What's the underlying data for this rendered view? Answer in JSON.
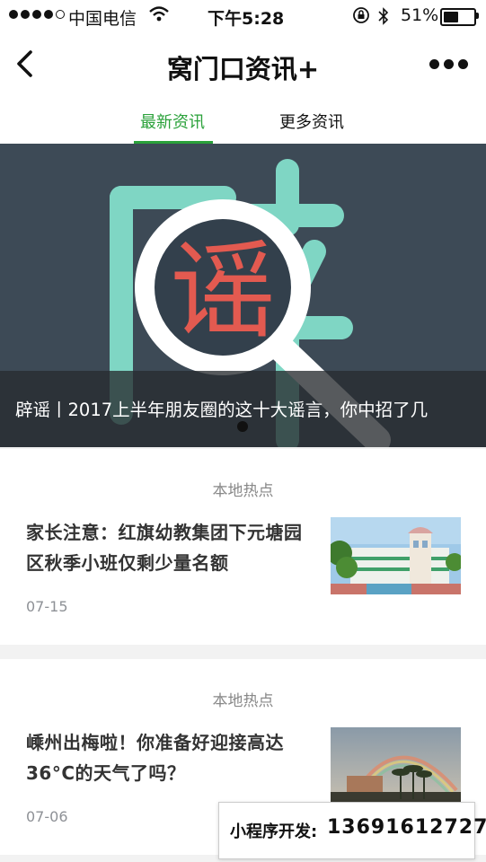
{
  "status_bar": {
    "carrier": "中国电信",
    "time": "下午5:28",
    "battery_percent": "51%",
    "battery_level": 0.51
  },
  "nav": {
    "title": "窝门口资讯+",
    "back_icon": "chevron-left-icon",
    "more_icon": "more-dots-icon"
  },
  "tabs": [
    {
      "label": "最新资讯",
      "active": true
    },
    {
      "label": "更多资讯",
      "active": false
    }
  ],
  "colors": {
    "accent": "#2aa13a",
    "banner_bg": "#3d4a56"
  },
  "banner": {
    "caption": "辟谣丨2017上半年朋友圈的这十大谣言，你中招了几",
    "image_glyph_big": "辟",
    "image_glyph_small": "谣"
  },
  "articles": [
    {
      "section": "本地热点",
      "title": "家长注意：红旗幼教集团下元塘园区秋季小班仅剩少量名额",
      "date": "07-15"
    },
    {
      "section": "本地热点",
      "title": "嵊州出梅啦！你准备好迎接高达36°C的天气了吗？",
      "date": "07-06"
    }
  ],
  "float_ad": {
    "label": "小程序开发:",
    "phone": "13691612727"
  }
}
